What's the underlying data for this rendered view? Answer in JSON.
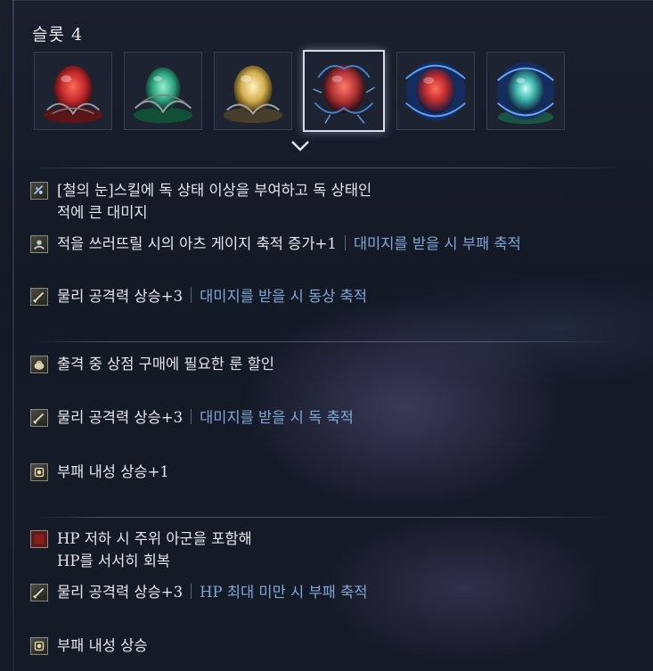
{
  "slot_title": "슬롯 4",
  "gems": [
    {
      "name": "crimson-relic-icon",
      "color": "#c42a2a",
      "selected": false
    },
    {
      "name": "green-relic-icon",
      "color": "#2fa880",
      "selected": false
    },
    {
      "name": "gold-relic-icon",
      "color": "#d4b050",
      "selected": false
    },
    {
      "name": "red-thorned-relic-icon",
      "color": "#b33535",
      "selected": true
    },
    {
      "name": "blue-red-relic-icon",
      "color": "#cc3030",
      "selected": false
    },
    {
      "name": "teal-relic-icon",
      "color": "#40b8b0",
      "selected": false
    }
  ],
  "effects": [
    {
      "icon": "eye-skill-icon",
      "text": "[철의 눈]스킬에 독 상태 이상을 부여하고 독 상태인",
      "text2": "적에 큰 대미지",
      "extra": ""
    },
    {
      "icon": "arts-gauge-icon",
      "text": "적을 쓰러뜨릴 시의 아츠 게이지 축적 증가+1",
      "extra": "대미지를 받을 시 부패 축적"
    },
    {
      "icon": "sword-icon",
      "text": "물리 공격력 상승+3",
      "extra": "대미지를 받을 시 동상 축적"
    },
    {
      "icon": "rune-bag-icon",
      "text": "출격 중 상점 구매에 필요한 룬 할인",
      "extra": ""
    },
    {
      "icon": "sword-icon",
      "text": "물리 공격력 상승+3",
      "extra": "대미지를 받을 시 독 축적"
    },
    {
      "icon": "rot-resist-icon",
      "text": "부패 내성 상승+1",
      "extra": ""
    },
    {
      "icon": "hp-restore-icon",
      "text": "HP 저하 시 주위 아군을 포함해",
      "text2": "HP를 서서히 회복",
      "extra": ""
    },
    {
      "icon": "sword-icon",
      "text": "물리 공격력 상승+3",
      "extra": "HP 최대 미만 시 부패 축적"
    },
    {
      "icon": "rot-resist-icon",
      "text": "부패 내성 상승",
      "extra": ""
    }
  ]
}
